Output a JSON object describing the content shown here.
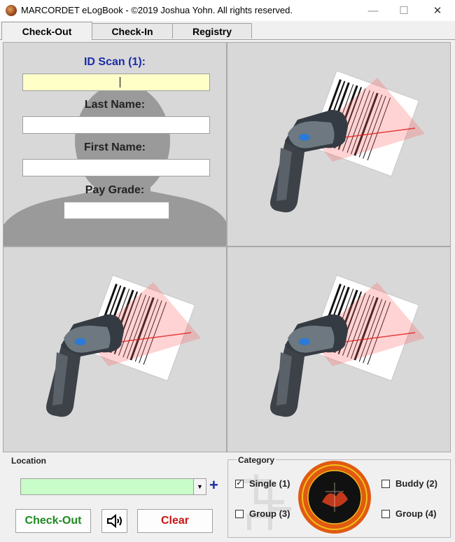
{
  "window": {
    "title": "MARCORDET eLogBook -  ©2019 Joshua Yohn. All rights reserved.",
    "minimize_icon": "minimize-icon",
    "maximize_icon": "maximize-icon",
    "close_icon": "close-icon"
  },
  "tabs": [
    {
      "label": "Check-Out",
      "active": true
    },
    {
      "label": "Check-In",
      "active": false
    },
    {
      "label": "Registry",
      "active": false
    }
  ],
  "form": {
    "id_scan_label": "ID Scan (1):",
    "id_scan_value": "",
    "last_name_label": "Last Name:",
    "last_name_value": "",
    "first_name_label": "First Name:",
    "first_name_value": "",
    "pay_grade_label": "Pay Grade:",
    "pay_grade_value": ""
  },
  "location": {
    "label": "Location",
    "value": "",
    "add_symbol": "+"
  },
  "buttons": {
    "checkout": "Check-Out",
    "clear": "Clear",
    "sound_icon": "speaker-icon"
  },
  "category": {
    "label": "Category",
    "options": [
      {
        "label": "Single (1)",
        "checked": true
      },
      {
        "label": "Group (3)",
        "checked": false
      },
      {
        "label": "Buddy (2)",
        "checked": false
      },
      {
        "label": "Group (4)",
        "checked": false
      }
    ]
  },
  "colors": {
    "id_scan_bg": "#ffffc8",
    "location_bg": "#c8fcc8",
    "label_blue": "#1a2ca8",
    "checkout_green": "#1e8a1e",
    "clear_red": "#c81414"
  }
}
